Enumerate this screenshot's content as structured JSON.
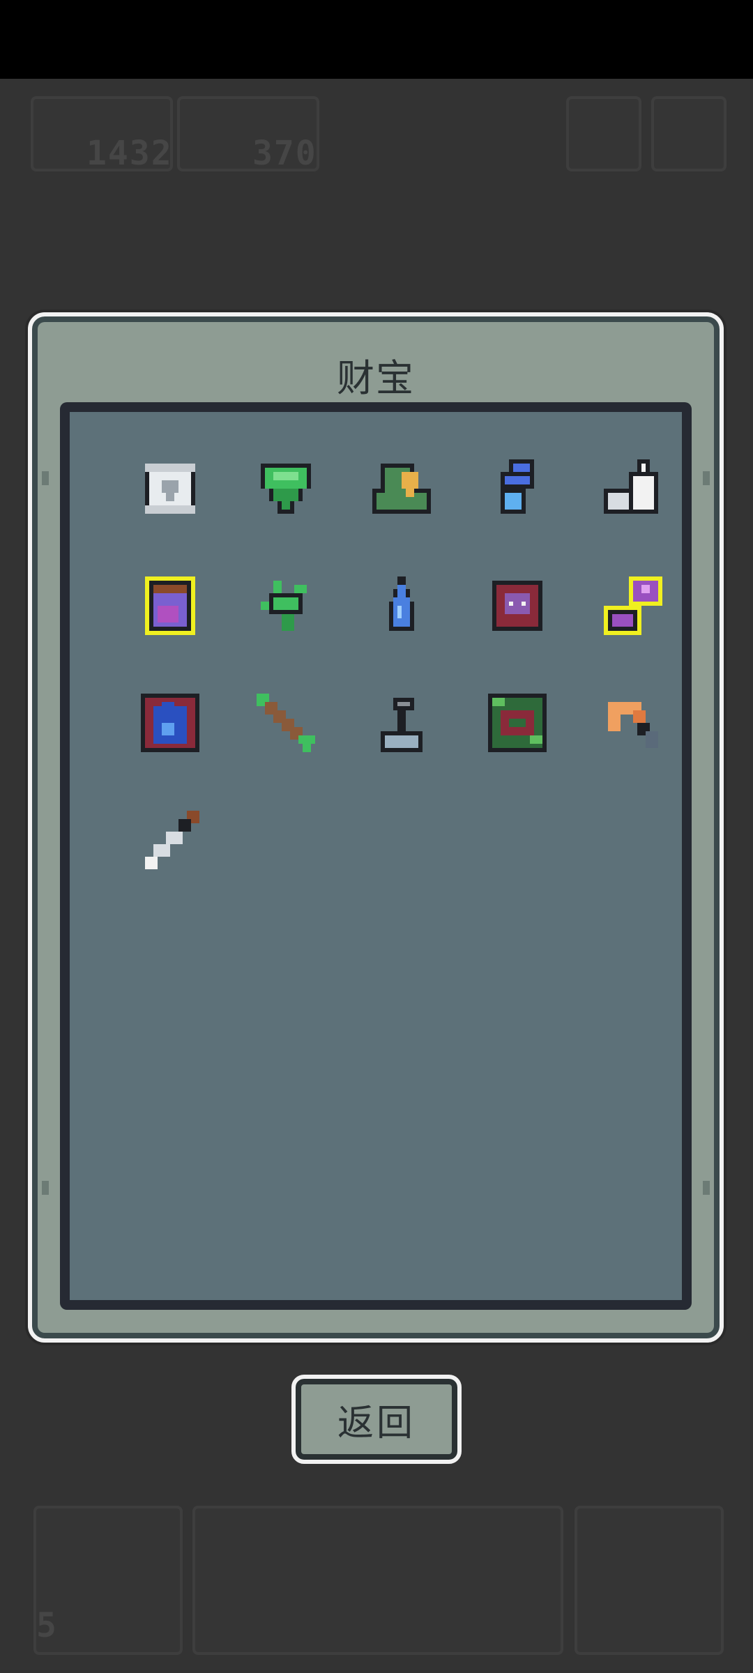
{
  "hud": {
    "resource_a_value": "1432",
    "resource_b_value": "370",
    "bottom_counter": "5"
  },
  "dialog": {
    "title": "财宝",
    "return_label": "返回"
  },
  "treasures": [
    {
      "name": "scroll-icon"
    },
    {
      "name": "green-gem-icon"
    },
    {
      "name": "green-hood-icon"
    },
    {
      "name": "blue-wisp-icon"
    },
    {
      "name": "white-fang-icon"
    },
    {
      "name": "potion-jar-icon"
    },
    {
      "name": "herb-sprout-icon"
    },
    {
      "name": "water-drop-icon"
    },
    {
      "name": "demon-shield-icon"
    },
    {
      "name": "purple-key-icon"
    },
    {
      "name": "blue-flame-tile-icon"
    },
    {
      "name": "arrow-icon"
    },
    {
      "name": "lever-icon"
    },
    {
      "name": "vine-tile-icon"
    },
    {
      "name": "orange-horn-icon"
    },
    {
      "name": "dagger-icon"
    }
  ]
}
